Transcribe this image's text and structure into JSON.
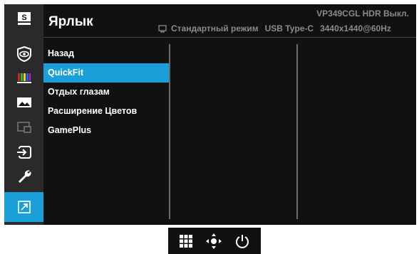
{
  "header": {
    "title": "Ярлык",
    "model_status": "VP349CGL HDR Выкл.",
    "mode": "Стандартный режим",
    "input": "USB Type-C",
    "resolution": "3440x1440@60Hz"
  },
  "sidebar": {
    "items": [
      {
        "icon": "splendid-icon",
        "label": "S"
      },
      {
        "icon": "eye-care-icon"
      },
      {
        "icon": "color-bars-icon"
      },
      {
        "icon": "image-icon"
      },
      {
        "icon": "pip-icon"
      },
      {
        "icon": "input-select-icon"
      },
      {
        "icon": "wrench-icon"
      },
      {
        "icon": "shortcut-icon",
        "active": true
      }
    ]
  },
  "menu": {
    "items": [
      {
        "label": "Назад"
      },
      {
        "label": "QuickFit",
        "selected": true
      },
      {
        "label": "Отдых глазам"
      },
      {
        "label": "Расширение Цветов"
      },
      {
        "label": "GamePlus"
      }
    ]
  },
  "controls": {
    "icons": [
      "menu-grid-icon",
      "joystick-icon",
      "power-icon"
    ]
  },
  "colors": {
    "accent": "#1a9fd8",
    "background": "#111111",
    "sidebar": "#2a2a2a",
    "status_text": "#8a8a8a"
  }
}
